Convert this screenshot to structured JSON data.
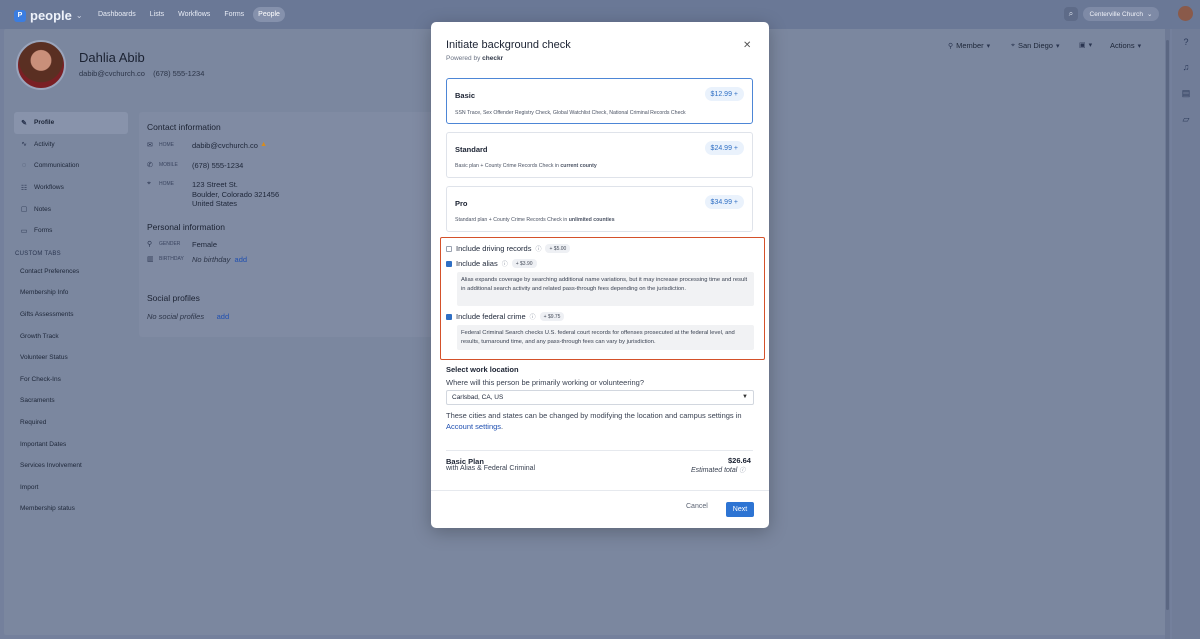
{
  "app": {
    "name": "people"
  },
  "topnav": [
    "Dashboards",
    "Lists",
    "Workflows",
    "Forms",
    "People"
  ],
  "topbar": {
    "org": "Centerville Church"
  },
  "person": {
    "name": "Dahlia Abib",
    "email": "dabib@cvchurch.co",
    "phone": "(678) 555-1234"
  },
  "header_actions": {
    "member": "Member",
    "location": "San Diego",
    "actions": "Actions"
  },
  "sidebar": {
    "items": [
      "Profile",
      "Activity",
      "Communication",
      "Workflows",
      "Notes",
      "Forms"
    ],
    "custom_tabs_heading": "CUSTOM TABS",
    "custom_tabs": [
      "Contact Preferences",
      "Membership Info",
      "Gifts Assessments",
      "Growth Track",
      "Volunteer Status",
      "For Check-Ins",
      "Sacraments",
      "Required",
      "Important Dates",
      "Services Involvement",
      "Import",
      "Membership status"
    ]
  },
  "contact": {
    "title": "Contact information",
    "home_label": "HOME",
    "email": "dabib@cvchurch.co",
    "mobile_label": "MOBILE",
    "phone": "(678) 555-1234",
    "addr_label": "HOME",
    "addr1": "123 Street St.",
    "addr2": "Boulder, Colorado 321456",
    "addr3": "United States"
  },
  "personal": {
    "title": "Personal information",
    "gender_label": "GENDER",
    "gender": "Female",
    "birthday_label": "BIRTHDAY",
    "birthday": "No birthday",
    "add": "add"
  },
  "social": {
    "title": "Social profiles",
    "empty": "No social profiles",
    "add": "add"
  },
  "modal": {
    "title": "Initiate background check",
    "powered": "Powered by",
    "brand": "checkr",
    "plans": [
      {
        "name": "Basic",
        "price": "$12.99 +",
        "desc": "SSN Trace, Sex Offender Registry Check, Global Watchlist Check, National Criminal Records Check"
      },
      {
        "name": "Standard",
        "price": "$24.99 +",
        "desc_prefix": "Basic plan + County Crime Records Check in ",
        "desc_bold": "current county"
      },
      {
        "name": "Pro",
        "price": "$34.99 +",
        "desc_prefix": "Standard plan + County Crime Records Check in ",
        "desc_bold": "unlimited counties"
      }
    ],
    "addons": [
      {
        "label": "Include driving records",
        "fee": "+ $5.00",
        "checked": false
      },
      {
        "label": "Include alias",
        "fee": "+ $3.90",
        "checked": true,
        "note": "Alias expands coverage by searching additional name variations, but it may increase processing time and result in additional search activity and related pass-through fees depending on the jurisdiction."
      },
      {
        "label": "Include federal crime",
        "fee": "+ $9.75",
        "checked": true,
        "note": "Federal Criminal Search checks U.S. federal court records for offenses prosecuted at the federal level, and results, turnaround time, and any pass-through fees can vary by jurisdiction."
      }
    ],
    "location": {
      "title": "Select work location",
      "question": "Where will this person be primarily working or volunteering?",
      "selected": "Carlsbad, CA, US",
      "help_prefix": "These cities and states can be changed by modifying the location and campus settings in ",
      "help_link": "Account settings",
      "help_suffix": "."
    },
    "summary": {
      "plan": "Basic Plan",
      "detail": "with Alias & Federal Criminal",
      "total": "$26.64",
      "total_label": "Estimated total"
    },
    "cancel": "Cancel",
    "next": "Next"
  },
  "colors": {
    "accent": "#2d74d3",
    "highlight_border": "#d4512a",
    "price_bg": "#eaf2fc"
  }
}
